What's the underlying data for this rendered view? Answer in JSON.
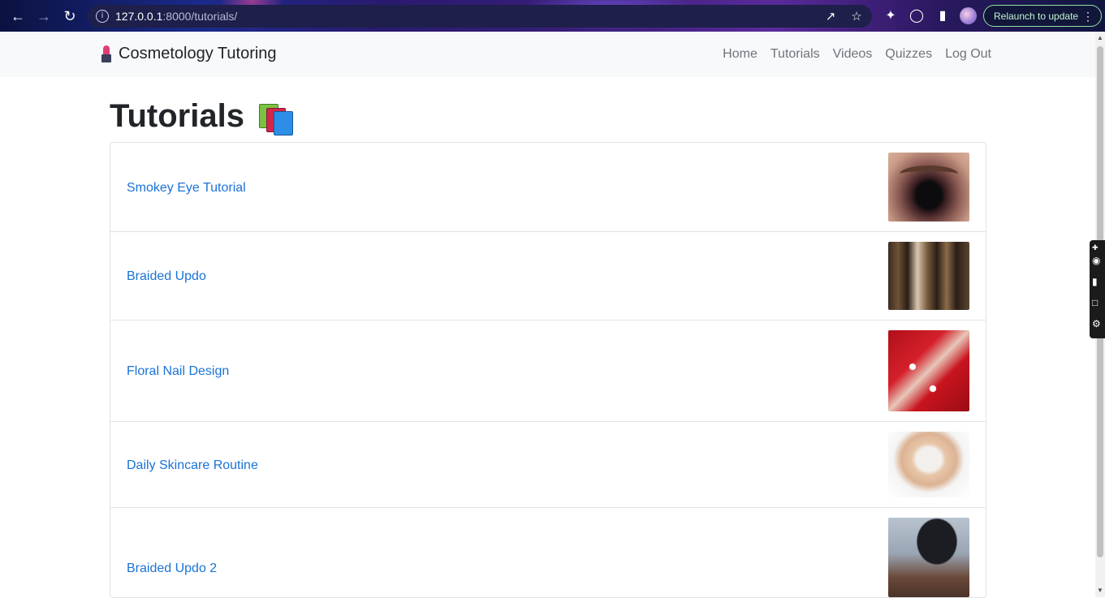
{
  "browser": {
    "url_host": "127.0.0.1",
    "url_rest": ":8000/tutorials/",
    "relaunch_label": "Relaunch to update",
    "icons": [
      "back-arrow-icon",
      "forward-arrow-icon",
      "reload-icon",
      "info-icon",
      "share-icon",
      "star-icon",
      "extensions-icon",
      "extension-icon",
      "sidebar-icon",
      "profile-avatar",
      "more-vert-icon"
    ]
  },
  "navbar": {
    "brand": "Cosmetology Tutoring",
    "brand_icon": "lipstick-icon",
    "links": [
      "Home",
      "Tutorials",
      "Videos",
      "Quizzes",
      "Log Out"
    ]
  },
  "page": {
    "title": "Tutorials",
    "title_icon": "books-icon"
  },
  "tutorials": [
    {
      "title": "Smokey Eye Tutorial",
      "thumbnail": "smokey-eye-photo"
    },
    {
      "title": "Braided Updo",
      "thumbnail": "braided-hair-photo"
    },
    {
      "title": "Floral Nail Design",
      "thumbnail": "red-floral-nails-photo"
    },
    {
      "title": "Daily Skincare Routine",
      "thumbnail": "face-mask-skincare-photo"
    },
    {
      "title": "Braided Updo 2",
      "thumbnail": "braided-bun-photo"
    }
  ],
  "colors": {
    "link": "#1a73d6",
    "navbar_bg": "#f8f9fa",
    "nav_link": "#6c757d"
  }
}
